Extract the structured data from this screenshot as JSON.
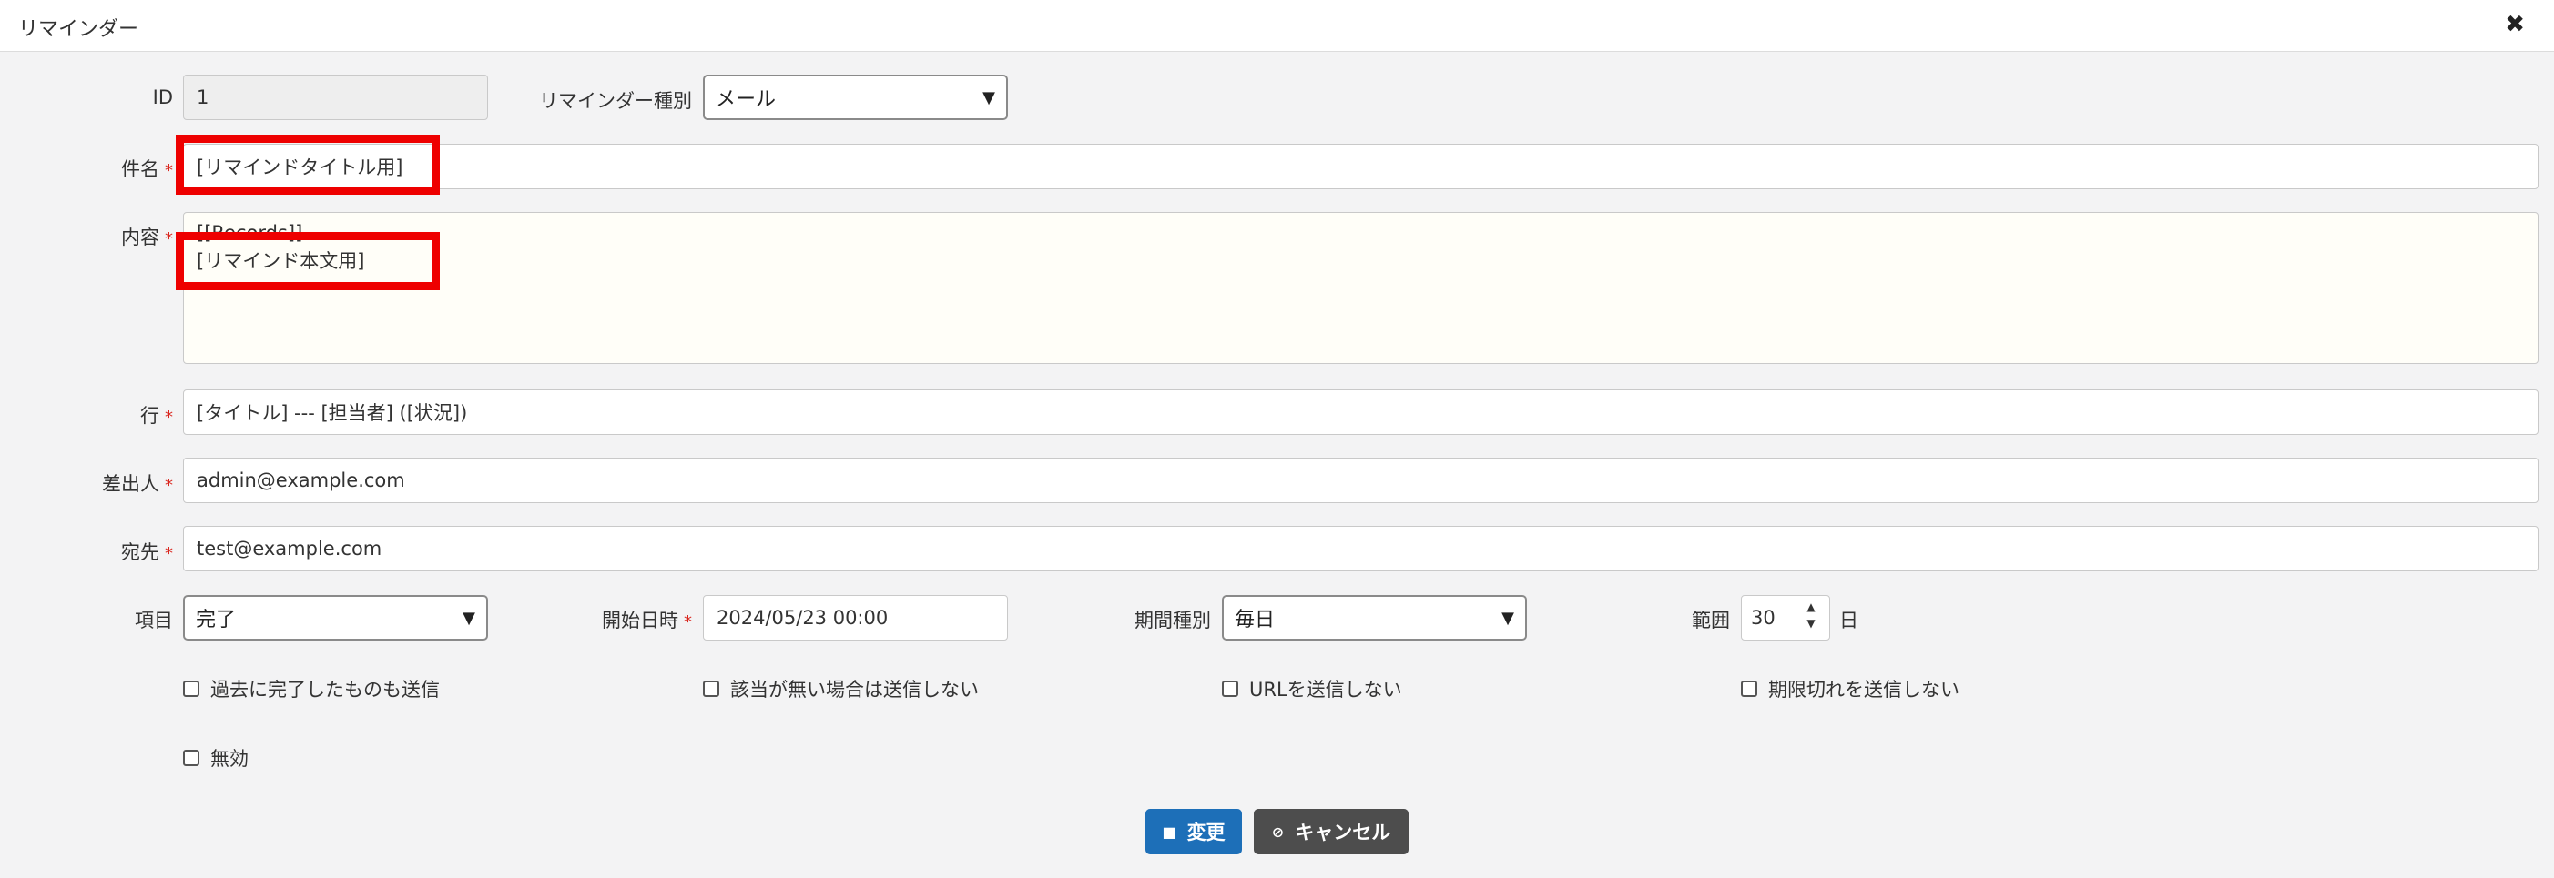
{
  "dialog": {
    "title": "リマインダー"
  },
  "form": {
    "id": {
      "label": "ID",
      "value": "1"
    },
    "reminder_type": {
      "label": "リマインダー種別",
      "value": "メール"
    },
    "subject": {
      "label": "件名",
      "required_mark": "*",
      "value": "[リマインドタイトル用]"
    },
    "body": {
      "label": "内容",
      "required_mark": "*",
      "line1": "[[Records]]",
      "line2": "[リマインド本文用]"
    },
    "line": {
      "label": "行",
      "required_mark": "*",
      "value": "[タイトル] --- [担当者] ([状況])"
    },
    "from": {
      "label": "差出人",
      "required_mark": "*",
      "value": "admin@example.com"
    },
    "to": {
      "label": "宛先",
      "required_mark": "*",
      "value": "test@example.com"
    },
    "column": {
      "label": "項目",
      "value": "完了"
    },
    "start_datetime": {
      "label": "開始日時",
      "required_mark": "*",
      "value": "2024/05/23 00:00"
    },
    "period_type": {
      "label": "期間種別",
      "value": "毎日"
    },
    "range": {
      "label": "範囲",
      "value": "30",
      "unit": "日"
    }
  },
  "checkboxes": {
    "send_completed_past": "過去に完了したものも送信",
    "not_send_if_none": "該当が無い場合は送信しない",
    "not_send_url": "URLを送信しない",
    "not_send_overdue": "期限切れを送信しない",
    "disabled": "無効"
  },
  "buttons": {
    "update": "変更",
    "cancel": "キャンセル"
  },
  "colors": {
    "primary": "#1d6fb8",
    "dark": "#4d4d4d",
    "required": "#d9251d",
    "highlight": "#ee0000"
  }
}
